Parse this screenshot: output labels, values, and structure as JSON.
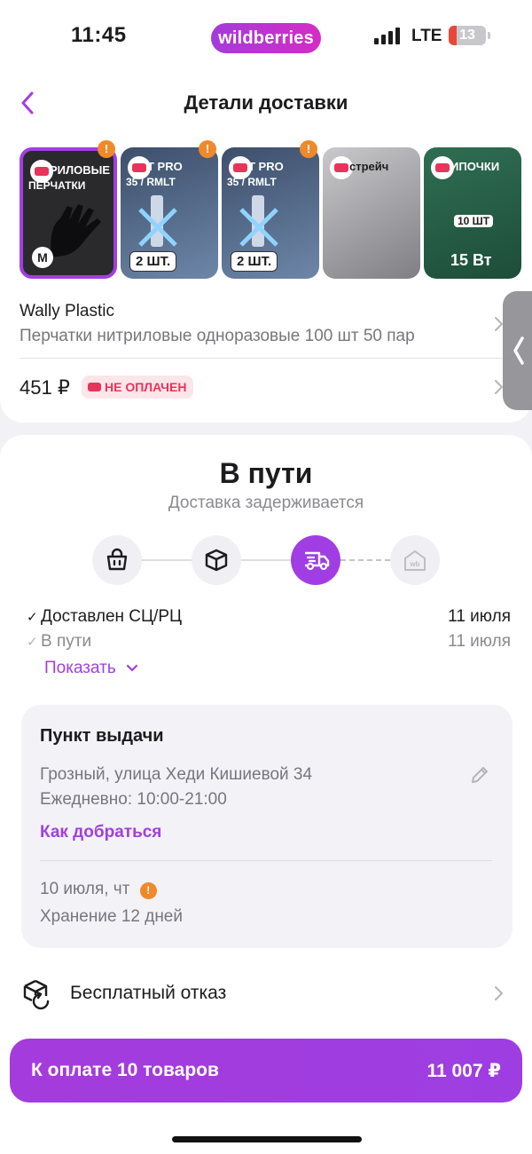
{
  "status_bar": {
    "time": "11:45",
    "brand": "wildberries",
    "network": "LTE",
    "battery": "13"
  },
  "header": {
    "title": "Детали доставки"
  },
  "thumbnails": [
    {
      "title": "РИЛОВЫЕ",
      "subtitle": "ПЕРЧАТКИ",
      "badge": "M",
      "bg": "#2a2a2c"
    },
    {
      "title": "T PRO",
      "subtitle": "35 / RMLT",
      "badge": "2 ШТ.",
      "bg": "#49607f"
    },
    {
      "title": "T PRO",
      "subtitle": "35 / RMLT",
      "badge": "2 ШТ.",
      "bg": "#49607f"
    },
    {
      "title": "стрейч",
      "subtitle": "",
      "badge": "",
      "bg": "#9a9a9e"
    },
    {
      "title": "ИПОЧКИ",
      "subtitle": "10 ШТ",
      "badge": "15 Вт",
      "bg": "#2f6e53"
    }
  ],
  "product": {
    "seller": "Wally Plastic",
    "name": "Перчатки нитриловые одноразовые 100 шт 50 пар",
    "price": "451 ₽",
    "payment_status": "НЕ ОПЛАЧЕН"
  },
  "status": {
    "title": "В пути",
    "subtitle": "Доставка задерживается",
    "steps": [
      {
        "icon": "shopping-bag-icon",
        "active": false
      },
      {
        "icon": "box-icon",
        "active": false
      },
      {
        "icon": "delivery-truck-icon",
        "active": true
      },
      {
        "icon": "wb-house-icon",
        "active": false
      }
    ],
    "events": [
      {
        "check": "✓",
        "label": "Доставлен СЦ/РЦ",
        "date": "11 июля",
        "faded": false
      },
      {
        "check": "✓",
        "label": "В пути",
        "date": "11 июля",
        "faded": true
      }
    ],
    "show_more": "Показать"
  },
  "pickup": {
    "title": "Пункт выдачи",
    "address": "Грозный, улица Хеди Кишиевой 34",
    "hours": "Ежедневно: 10:00-21:00",
    "route_link": "Как добраться",
    "date": "10 июля, чт",
    "storage": "Хранение 12 дней"
  },
  "refusal": {
    "label": "Бесплатный отказ"
  },
  "checkout": {
    "label": "К оплате 10 товаров",
    "total": "11 007 ₽"
  },
  "colors": {
    "accent": "#a13ee3",
    "warning": "#f0892a",
    "danger": "#e8335a"
  }
}
